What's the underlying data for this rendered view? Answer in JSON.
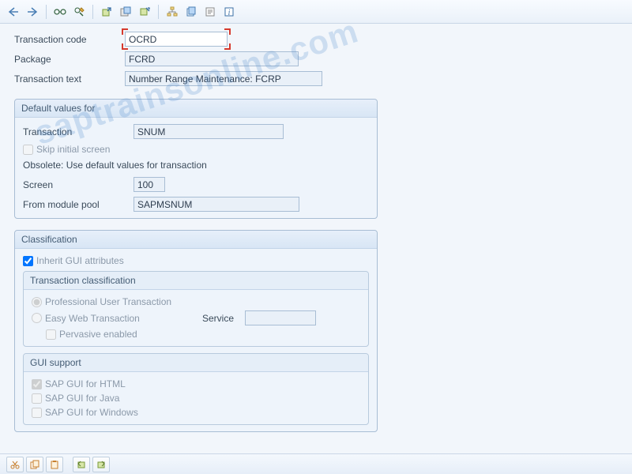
{
  "header": {
    "transaction_code_label": "Transaction code",
    "transaction_code_value": "OCRD",
    "package_label": "Package",
    "package_value": "FCRD",
    "transaction_text_label": "Transaction text",
    "transaction_text_value": "Number Range Maintenance: FCRP"
  },
  "default_values": {
    "title": "Default values for",
    "transaction_label": "Transaction",
    "transaction_value": "SNUM",
    "skip_initial_label": "Skip initial screen",
    "obsolete_text": "Obsolete: Use default values for transaction",
    "screen_label": "Screen",
    "screen_value": "100",
    "from_module_pool_label": "From module pool",
    "from_module_pool_value": "SAPMSNUM"
  },
  "classification": {
    "title": "Classification",
    "inherit_label": "Inherit GUI attributes",
    "inherit_checked": true,
    "sub_title": "Transaction classification",
    "professional_label": "Professional User Transaction",
    "easy_web_label": "Easy Web Transaction",
    "service_label": "Service",
    "service_value": "",
    "pervasive_label": "Pervasive enabled"
  },
  "gui_support": {
    "title": "GUI support",
    "html_label": "SAP GUI for HTML",
    "html_checked": true,
    "java_label": "SAP GUI for Java",
    "windows_label": "SAP GUI for Windows"
  },
  "watermark": "saptrainsonline.com"
}
